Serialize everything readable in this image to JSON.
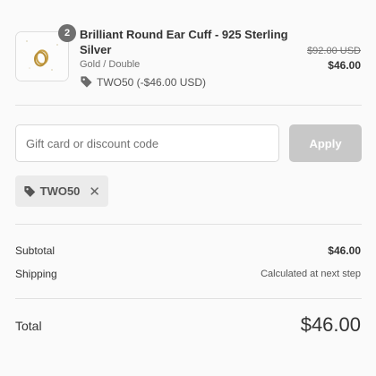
{
  "line_item": {
    "quantity": "2",
    "title": "Brilliant Round Ear Cuff - 925 Sterling Silver",
    "variant": "Gold / Double",
    "discount": "TWO50 (-$46.00 USD)",
    "price_original": "$92.00 USD",
    "price_final": "$46.00"
  },
  "discount_form": {
    "placeholder": "Gift card or discount code",
    "value": "",
    "apply_label": "Apply"
  },
  "applied_code": {
    "code": "TWO50"
  },
  "summary": {
    "subtotal_label": "Subtotal",
    "subtotal_value": "$46.00",
    "shipping_label": "Shipping",
    "shipping_value": "Calculated at next step",
    "total_label": "Total",
    "total_value": "$46.00"
  },
  "icons": {
    "tag": "tag-icon",
    "remove": "close-icon"
  }
}
